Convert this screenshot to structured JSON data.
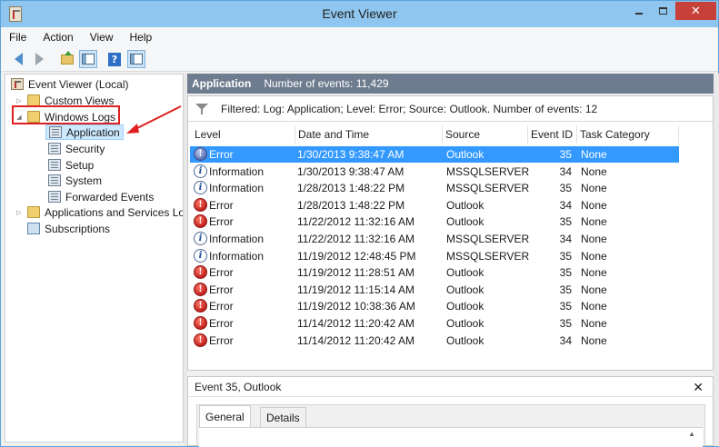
{
  "window": {
    "title": "Event Viewer",
    "close_glyph": "✕"
  },
  "menu": [
    "File",
    "Action",
    "View",
    "Help"
  ],
  "toolbar": {
    "icons": [
      "back-arrow-icon",
      "forward-arrow-icon",
      "folder-up-icon",
      "show-pane-icon",
      "help-icon",
      "action-pane-icon"
    ],
    "help_glyph": "?"
  },
  "tree": {
    "root": "Event Viewer (Local)",
    "custom_views": "Custom Views",
    "windows_logs": "Windows Logs",
    "logs": [
      "Application",
      "Security",
      "Setup",
      "System",
      "Forwarded Events"
    ],
    "apps_services": "Applications and Services Lo",
    "subscriptions": "Subscriptions",
    "expanded_glyph": "◢",
    "collapsed_glyph": "▷"
  },
  "pane": {
    "title": "Application",
    "count": "Number of events: 11,429",
    "filter": "Filtered: Log: Application; Level: Error; Source: Outlook. Number of events: 12"
  },
  "columns": [
    "Level",
    "Date and Time",
    "Source",
    "Event ID",
    "Task Category"
  ],
  "events": [
    {
      "level": "Error",
      "datetime": "1/30/2013 9:38:47 AM",
      "source": "Outlook",
      "id": "35",
      "task": "None",
      "selected": true
    },
    {
      "level": "Information",
      "datetime": "1/30/2013 9:38:47 AM",
      "source": "MSSQLSERVER",
      "id": "34",
      "task": "None"
    },
    {
      "level": "Information",
      "datetime": "1/28/2013 1:48:22 PM",
      "source": "MSSQLSERVER",
      "id": "35",
      "task": "None"
    },
    {
      "level": "Error",
      "datetime": "1/28/2013 1:48:22 PM",
      "source": "Outlook",
      "id": "34",
      "task": "None"
    },
    {
      "level": "Error",
      "datetime": "11/22/2012 11:32:16 AM",
      "source": "Outlook",
      "id": "35",
      "task": "None"
    },
    {
      "level": "Information",
      "datetime": "11/22/2012 11:32:16 AM",
      "source": "MSSQLSERVER",
      "id": "34",
      "task": "None"
    },
    {
      "level": "Information",
      "datetime": "11/19/2012 12:48:45 PM",
      "source": "MSSQLSERVER",
      "id": "35",
      "task": "None"
    },
    {
      "level": "Error",
      "datetime": "11/19/2012 11:28:51 AM",
      "source": "Outlook",
      "id": "35",
      "task": "None"
    },
    {
      "level": "Error",
      "datetime": "11/19/2012 11:15:14 AM",
      "source": "Outlook",
      "id": "35",
      "task": "None"
    },
    {
      "level": "Error",
      "datetime": "11/19/2012 10:38:36 AM",
      "source": "Outlook",
      "id": "35",
      "task": "None"
    },
    {
      "level": "Error",
      "datetime": "11/14/2012 11:20:42 AM",
      "source": "Outlook",
      "id": "35",
      "task": "None"
    },
    {
      "level": "Error",
      "datetime": "11/14/2012 11:20:42 AM",
      "source": "Outlook",
      "id": "34",
      "task": "None"
    }
  ],
  "detail": {
    "title": "Event 35, Outlook",
    "close": "✕",
    "tabs": [
      "General",
      "Details"
    ]
  },
  "colors": {
    "titlebar": "#8fc6ef",
    "header": "#6e7c8f",
    "selection": "#3399ff",
    "annotation": "#e02020"
  }
}
